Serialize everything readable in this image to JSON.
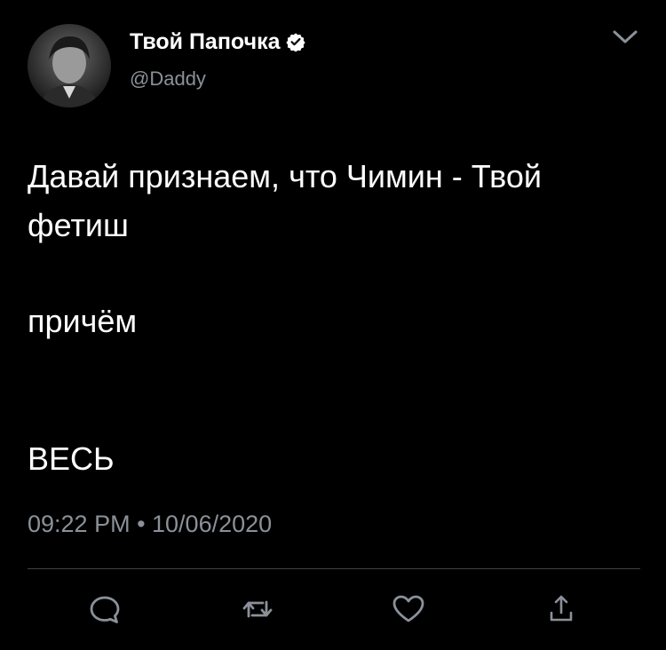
{
  "author": {
    "display_name": "Твой Папочка",
    "handle": "@Daddy",
    "verified": true,
    "avatar_icon": "profile-photo"
  },
  "tweet": {
    "lines": [
      "Давай признаем, что Чимин - Твой",
      "фетиш",
      "причём",
      "ВЕСЬ"
    ],
    "timestamp": "09:22 PM • 10/06/2020"
  },
  "actions": [
    {
      "name": "reply",
      "icon": "speech-bubble-icon"
    },
    {
      "name": "retweet",
      "icon": "retweet-arrows-icon"
    },
    {
      "name": "like",
      "icon": "heart-icon"
    },
    {
      "name": "share",
      "icon": "share-upload-icon"
    }
  ],
  "colors": {
    "background": "#000000",
    "text": "#ffffff",
    "secondary_text": "#8b9199",
    "divider": "#3d4248"
  }
}
